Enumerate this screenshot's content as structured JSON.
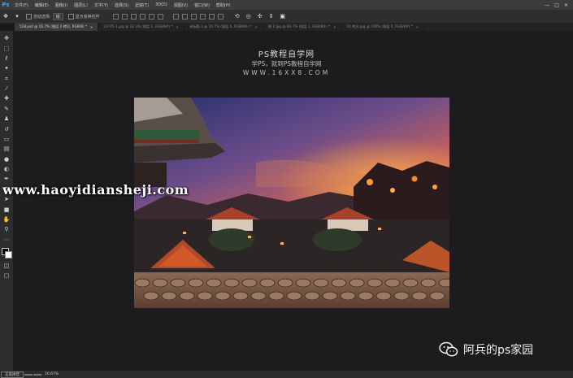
{
  "app": {
    "logo": "Ps",
    "menus": [
      "文件(F)",
      "编辑(E)",
      "图像(I)",
      "图层(L)",
      "文字(Y)",
      "选择(S)",
      "滤镜(T)",
      "3D(D)",
      "视图(V)",
      "窗口(W)",
      "帮助(H)"
    ],
    "window_controls": [
      "—",
      "□",
      "✕"
    ]
  },
  "options": {
    "auto_select_label": "自动选择:",
    "auto_select_value": "组",
    "show_transform_label": "显示变换控件"
  },
  "tabs": [
    {
      "label": "518.psd @ 16.7% (图层 2 拷贝, RGB/8) *",
      "active": true
    },
    {
      "label": "23705-1.jpg @ 33.3% (图层 1, RGB/8#) *",
      "active": false
    },
    {
      "label": "未标题-1 @ 16.7% (图层 0, RGB/8#) *",
      "active": false
    },
    {
      "label": "图 2.jpg @ 66.7% (图层 1, RGB/8#) *",
      "active": false
    },
    {
      "label": "10 拷贝.jpg @ 100% (图层 0, RGB/8#) *",
      "active": false
    }
  ],
  "tools": [
    "move-icon",
    "marquee-icon",
    "lasso-icon",
    "magic-wand-icon",
    "crop-icon",
    "eyedropper-icon",
    "healing-icon",
    "brush-icon",
    "stamp-icon",
    "history-brush-icon",
    "eraser-icon",
    "gradient-icon",
    "blur-icon",
    "dodge-icon",
    "pen-icon",
    "type-icon",
    "path-select-icon",
    "shape-icon",
    "hand-icon",
    "zoom-icon",
    "more-icon"
  ],
  "watermark": {
    "title": "PS教程自学网",
    "subtitle": "学PS，就到PS教程自学网",
    "url": "WWW.16XX8.COM"
  },
  "site_watermark": "www.haoyidiansheji.com",
  "brand": {
    "name": "阿兵的ps家园",
    "icon": "wechat-icon"
  },
  "status": {
    "items": [
      "五笔拼音",
      "",
      "",
      "16.67%"
    ]
  },
  "colors": {
    "foreground": "#000000",
    "background": "#ffffff"
  }
}
